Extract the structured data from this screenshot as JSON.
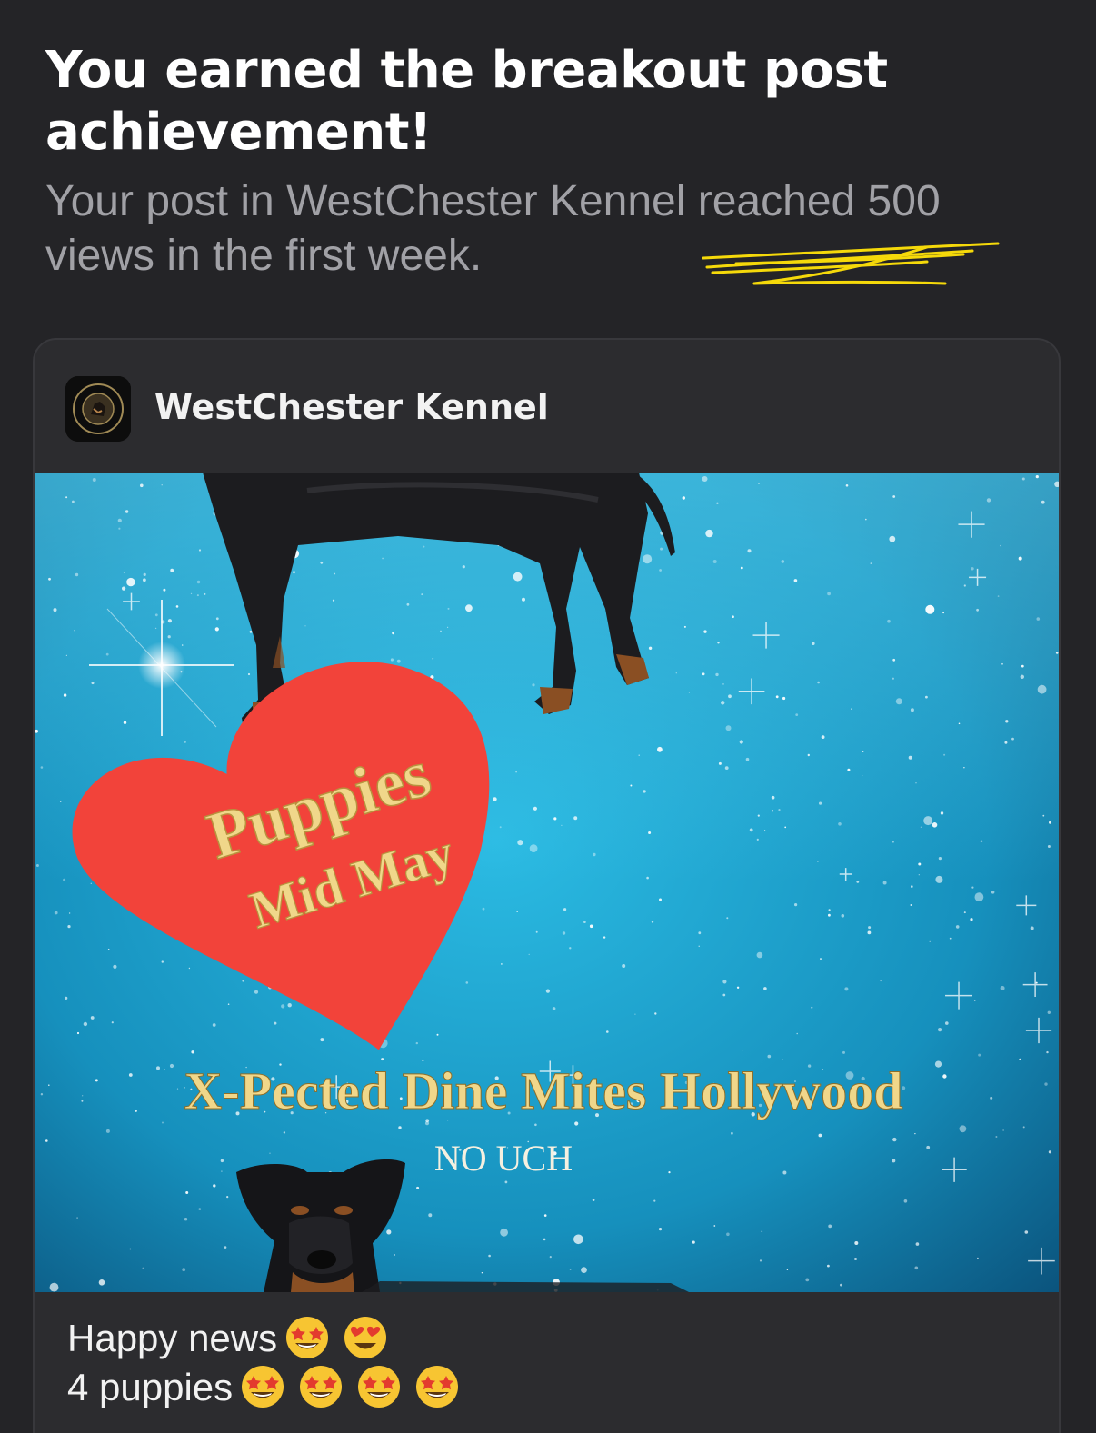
{
  "achievement": {
    "title": "You earned the breakout post achievement!",
    "subtitle": "Your post in WestChester Kennel reached 500 views in the first week."
  },
  "post": {
    "group_name": "WestChester Kennel",
    "avatar_icon": "westchester-kennel-logo",
    "image": {
      "heart_line1": "Puppies",
      "heart_line2": "Mid May",
      "dog_name": "X-Pected Dine Mites Hollywood",
      "dog_title": "NO UCH",
      "background_color": "#1fa9d6",
      "heart_color": "#f2433a",
      "text_color": "#f0d78a"
    },
    "text_line1": "Happy news",
    "text_line1_emojis": [
      "star-struck-emoji",
      "heart-eyes-emoji"
    ],
    "text_line2": "4 puppies",
    "text_line2_emojis": [
      "star-struck-emoji",
      "star-struck-emoji",
      "star-struck-emoji",
      "star-struck-emoji"
    ]
  },
  "colors": {
    "background": "#242427",
    "card": "#2c2c2f",
    "subtitle_text": "#a1a1a6",
    "scribble": "#f5d90a"
  }
}
